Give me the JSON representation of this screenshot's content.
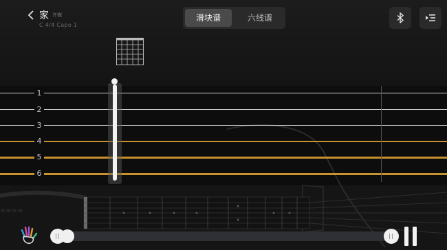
{
  "header": {
    "title": "家",
    "author": "许巍",
    "meta": "C 4/4  Capo 1",
    "back_icon": "chevron-left-icon"
  },
  "view_tabs": [
    {
      "label": "滑块谱",
      "selected": true
    },
    {
      "label": "六线谱",
      "selected": false
    }
  ],
  "toolbar": {
    "bluetooth_icon": "bluetooth-icon",
    "menu_icon": "playlist-menu-icon"
  },
  "strings": [
    "1",
    "2",
    "3",
    "4",
    "5",
    "6"
  ],
  "colors": {
    "string_plain": "#d6d6d6",
    "string_wound": "#c8922e",
    "tab_selected": "#4a4a4a",
    "control_bg": "#2a2a2a"
  },
  "player": {
    "hand_icon": "colored-hand-icon",
    "pause_icon": "pause-icon",
    "range_start": 0.0,
    "range_end": 1.0
  }
}
